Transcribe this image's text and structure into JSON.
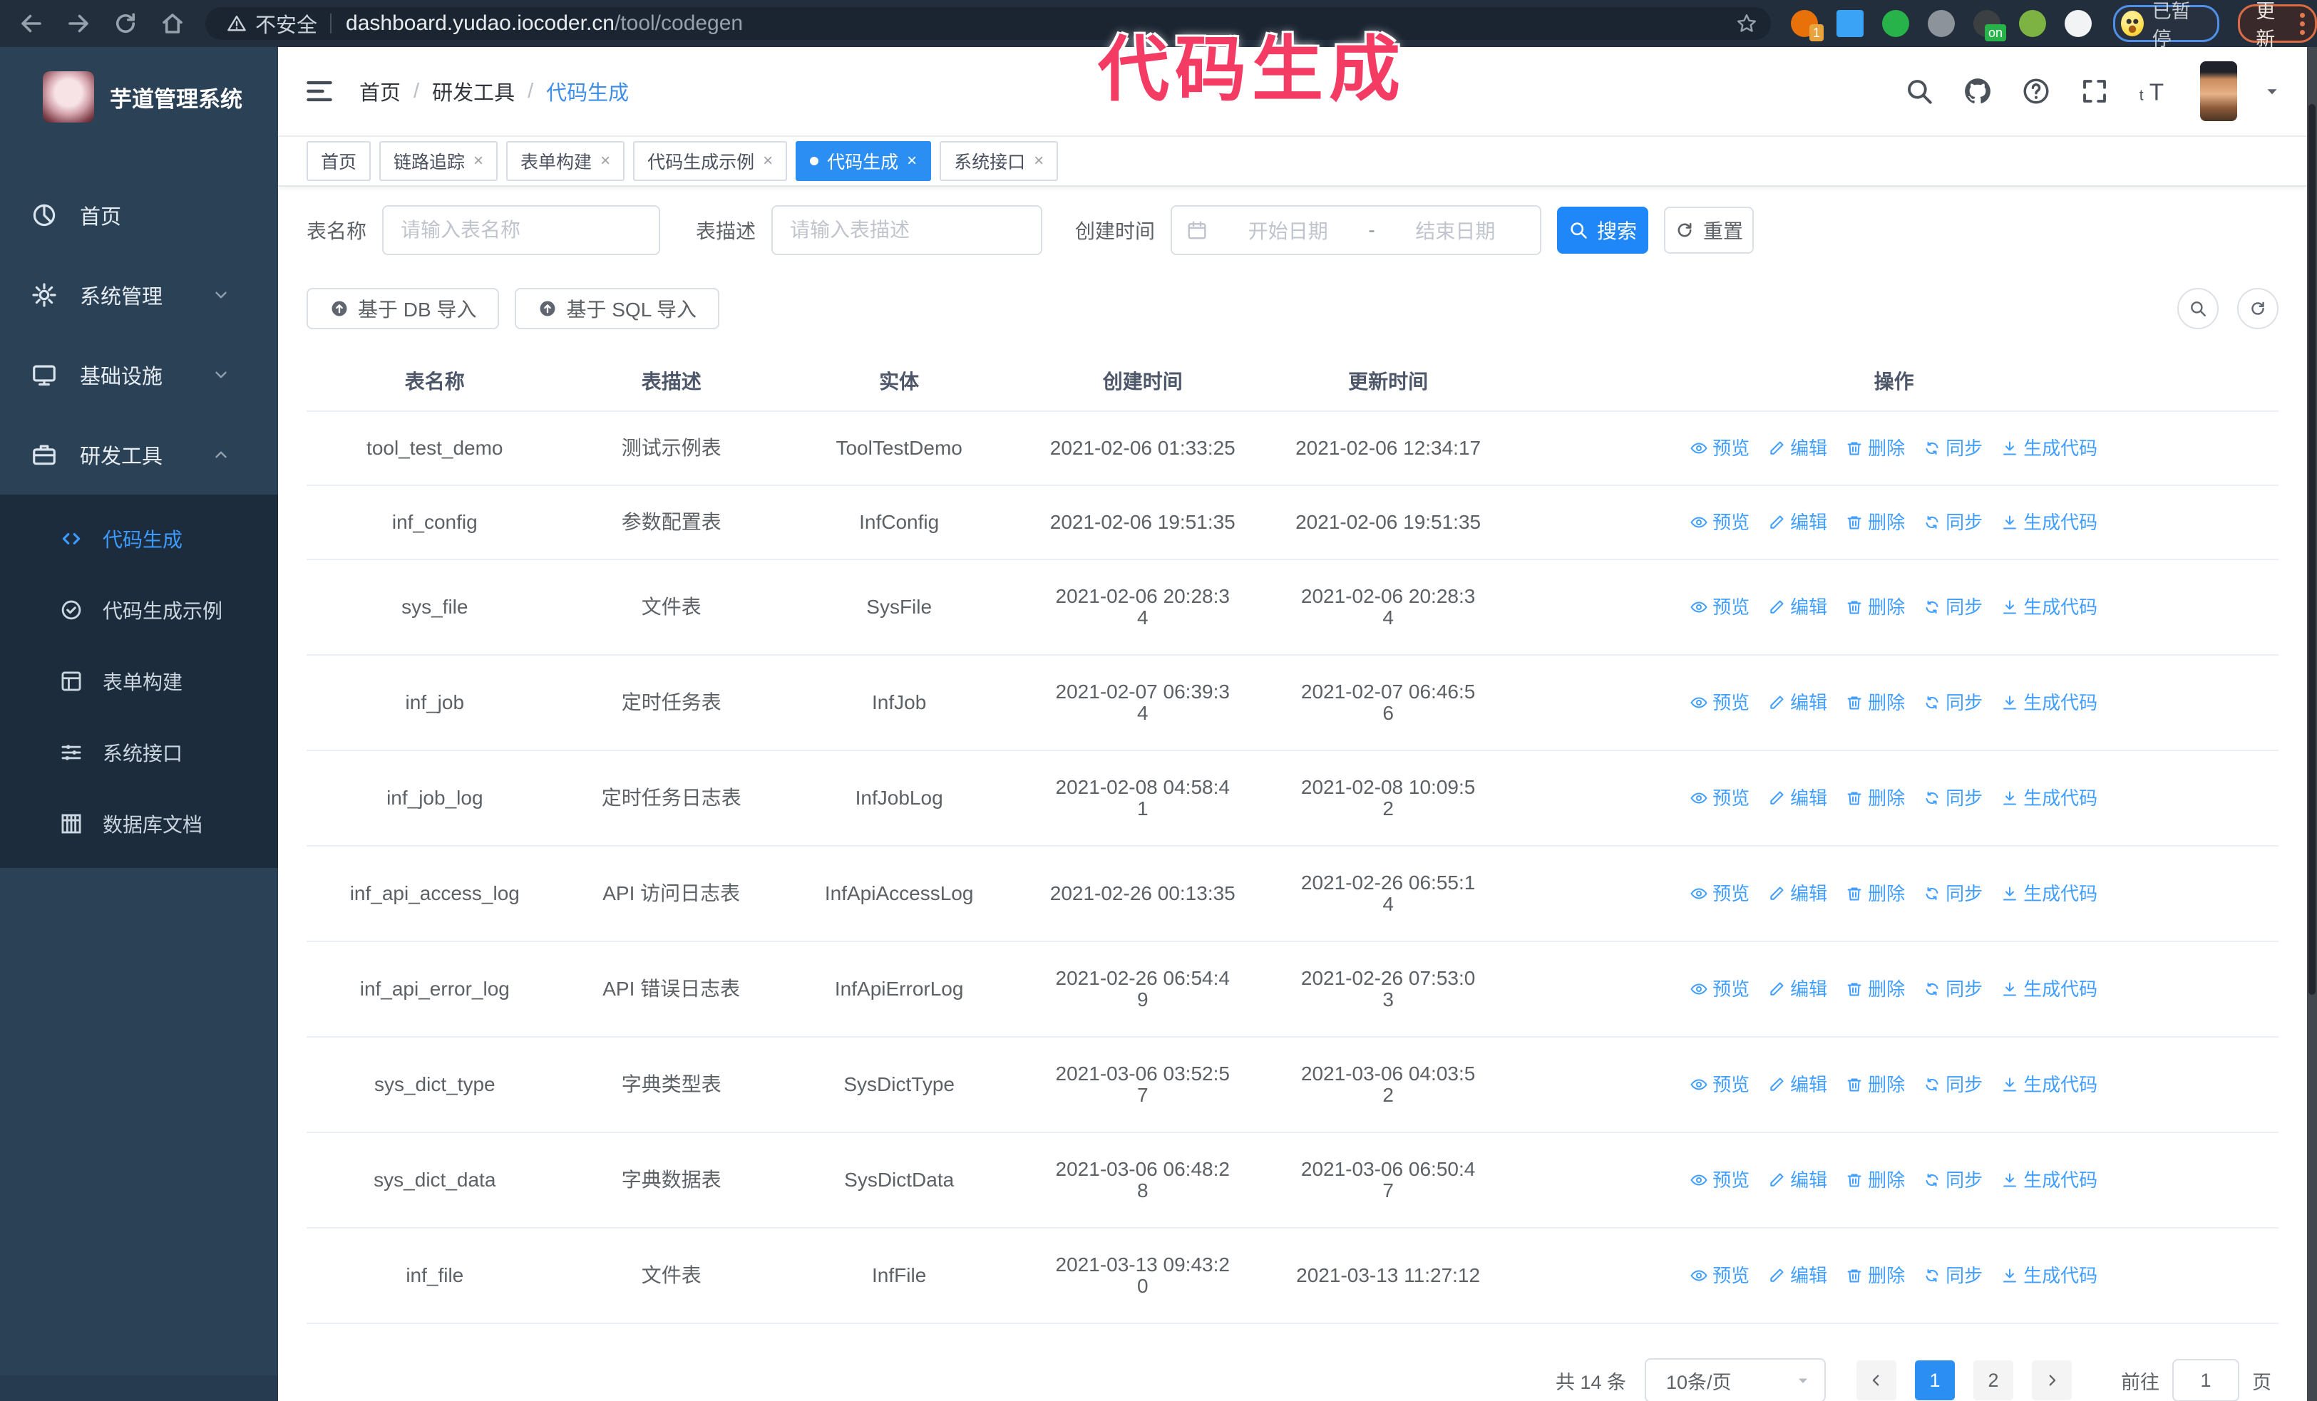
{
  "accent": "#2b8ef3",
  "link_color": "#409eff",
  "sidebar_bg": "#2b4156",
  "submenu_bg": "#1c2c3c",
  "chrome_bg": "#222e3c",
  "overlay": {
    "annotation": "代码生成",
    "color": "#f43b63"
  },
  "browser": {
    "nav_icons": [
      "back",
      "forward",
      "reload",
      "home"
    ],
    "not_secure": "不安全",
    "url_host": "dashboard.yudao.iocoder.cn",
    "url_path": "/tool/codegen",
    "star_icon": "star",
    "extensions": [
      {
        "name": "ext-orange",
        "color": "#e8710a",
        "badge": "1",
        "badge_color": "#e8a33d"
      },
      {
        "name": "ext-gem",
        "color": "#3aa3f5",
        "badge": "",
        "badge_color": ""
      },
      {
        "name": "ext-green-check",
        "color": "#27b24a",
        "badge": "",
        "badge_color": ""
      },
      {
        "name": "ext-gray-grid",
        "color": "#8d939b",
        "badge": "",
        "badge_color": ""
      },
      {
        "name": "ext-dark-rows",
        "color": "#3c4043",
        "badge": "on",
        "badge_color": "#27b24a"
      },
      {
        "name": "ext-green-key",
        "color": "#7cb342",
        "badge": "",
        "badge_color": ""
      },
      {
        "name": "ext-puzzle",
        "color": "#f1f3f4",
        "badge": "",
        "badge_color": ""
      }
    ],
    "paused_badge": "已暂停",
    "update_button": "更新"
  },
  "sidebar": {
    "logo_title": "芋道管理系统",
    "items": [
      {
        "label": "首页",
        "icon": "dashboard",
        "chevron": ""
      },
      {
        "label": "系统管理",
        "icon": "gear",
        "chevron": "down"
      },
      {
        "label": "基础设施",
        "icon": "monitor",
        "chevron": "down"
      },
      {
        "label": "研发工具",
        "icon": "briefcase",
        "chevron": "up",
        "expanded": true
      }
    ],
    "submenu": [
      {
        "label": "代码生成",
        "icon": "code",
        "active": true
      },
      {
        "label": "代码生成示例",
        "icon": "badge-check",
        "active": false
      },
      {
        "label": "表单构建",
        "icon": "form",
        "active": false
      },
      {
        "label": "系统接口",
        "icon": "sliders",
        "active": false
      },
      {
        "label": "数据库文档",
        "icon": "db-grid",
        "active": false
      }
    ]
  },
  "header": {
    "breadcrumb": [
      "首页",
      "研发工具",
      "代码生成"
    ],
    "right_icons": [
      "search",
      "github",
      "question",
      "fullscreen",
      "font-size"
    ]
  },
  "tabs": [
    {
      "label": "首页",
      "closable": false,
      "active": false
    },
    {
      "label": "链路追踪",
      "closable": true,
      "active": false
    },
    {
      "label": "表单构建",
      "closable": true,
      "active": false
    },
    {
      "label": "代码生成示例",
      "closable": true,
      "active": false
    },
    {
      "label": "代码生成",
      "closable": true,
      "active": true
    },
    {
      "label": "系统接口",
      "closable": true,
      "active": false
    }
  ],
  "filters": {
    "name_label": "表名称",
    "name_placeholder": "请输入表名称",
    "desc_label": "表描述",
    "desc_placeholder": "请输入表描述",
    "time_label": "创建时间",
    "start_placeholder": "开始日期",
    "range_separator": "-",
    "end_placeholder": "结束日期",
    "search_label": "搜索",
    "reset_label": "重置"
  },
  "toolbar": {
    "db_import_label": "基于 DB 导入",
    "sql_import_label": "基于 SQL 导入"
  },
  "table": {
    "columns": [
      "表名称",
      "表描述",
      "实体",
      "创建时间",
      "更新时间",
      "操作"
    ],
    "action_labels": [
      "预览",
      "编辑",
      "删除",
      "同步",
      "生成代码"
    ],
    "action_icons": [
      "eye",
      "edit",
      "trash",
      "sync",
      "download"
    ],
    "rows": [
      {
        "name": "tool_test_demo",
        "desc": "测试示例表",
        "entity": "ToolTestDemo",
        "created": "2021-02-06 01:33:25",
        "updated": "2021-02-06 12:34:17"
      },
      {
        "name": "inf_config",
        "desc": "参数配置表",
        "entity": "InfConfig",
        "created": "2021-02-06 19:51:35",
        "updated": "2021-02-06 19:51:35"
      },
      {
        "name": "sys_file",
        "desc": "文件表",
        "entity": "SysFile",
        "created": "2021-02-06 20:28:3\n4",
        "updated": "2021-02-06 20:28:3\n4"
      },
      {
        "name": "inf_job",
        "desc": "定时任务表",
        "entity": "InfJob",
        "created": "2021-02-07 06:39:3\n4",
        "updated": "2021-02-07 06:46:5\n6"
      },
      {
        "name": "inf_job_log",
        "desc": "定时任务日志表",
        "entity": "InfJobLog",
        "created": "2021-02-08 04:58:4\n1",
        "updated": "2021-02-08 10:09:5\n2"
      },
      {
        "name": "inf_api_access_log",
        "desc": "API 访问日志表",
        "entity": "InfApiAccessLog",
        "created": "2021-02-26 00:13:35",
        "updated": "2021-02-26 06:55:1\n4"
      },
      {
        "name": "inf_api_error_log",
        "desc": "API 错误日志表",
        "entity": "InfApiErrorLog",
        "created": "2021-02-26 06:54:4\n9",
        "updated": "2021-02-26 07:53:0\n3"
      },
      {
        "name": "sys_dict_type",
        "desc": "字典类型表",
        "entity": "SysDictType",
        "created": "2021-03-06 03:52:5\n7",
        "updated": "2021-03-06 04:03:5\n2"
      },
      {
        "name": "sys_dict_data",
        "desc": "字典数据表",
        "entity": "SysDictData",
        "created": "2021-03-06 06:48:2\n8",
        "updated": "2021-03-06 06:50:4\n7"
      },
      {
        "name": "inf_file",
        "desc": "文件表",
        "entity": "InfFile",
        "created": "2021-03-13 09:43:2\n0",
        "updated": "2021-03-13 11:27:12"
      }
    ]
  },
  "pagination": {
    "total_text": "共 14 条",
    "page_size_text": "10条/页",
    "pages": [
      "1",
      "2"
    ],
    "active_page": "1",
    "goto_label": "前往",
    "goto_value": "1",
    "page_unit": "页"
  }
}
